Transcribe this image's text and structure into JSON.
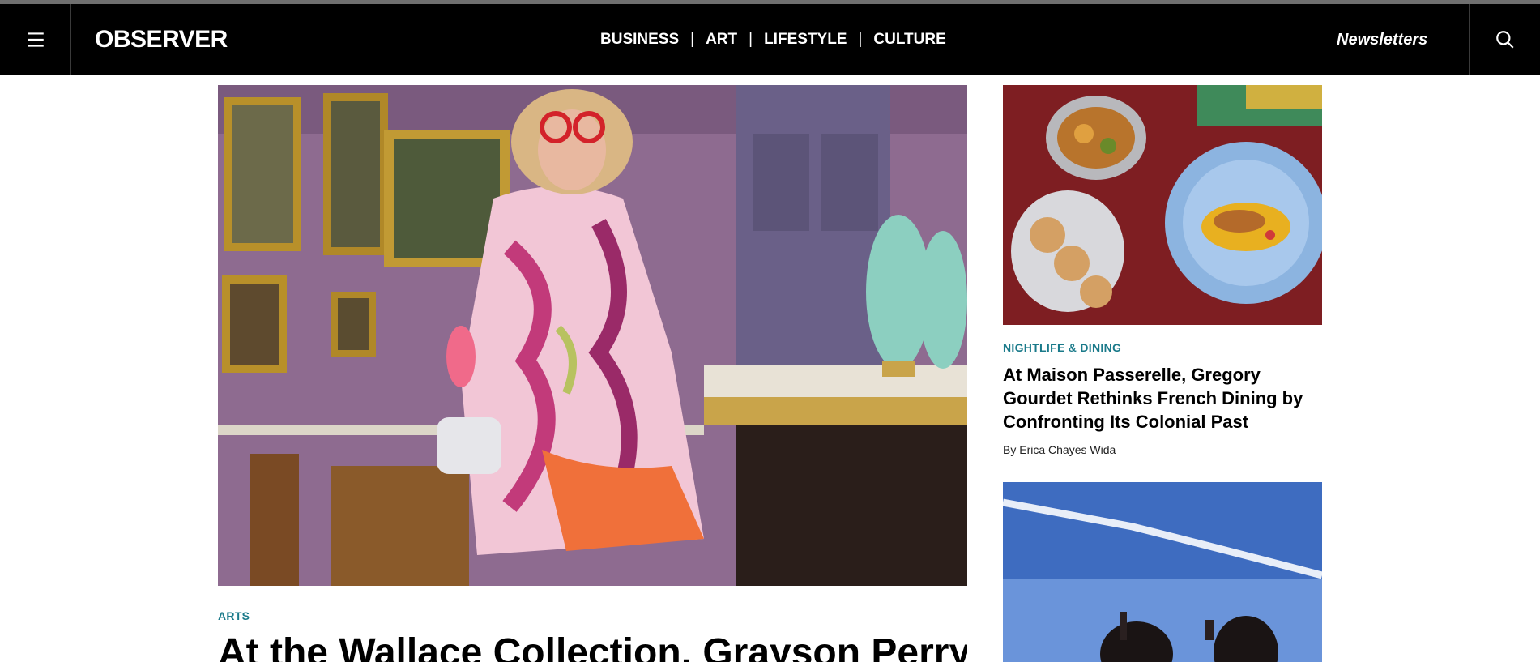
{
  "header": {
    "logo": "OBSERVER",
    "nav": [
      "BUSINESS",
      "ART",
      "LIFESTYLE",
      "CULTURE"
    ],
    "nav_separator": "|",
    "newsletters_label": "Newsletters",
    "menu_icon": "hamburger-menu-icon",
    "search_icon": "search-icon"
  },
  "feature": {
    "category": "ARTS",
    "title": "At the Wallace Collection, Grayson Perry"
  },
  "side_story": {
    "category": "NIGHTLIFE & DINING",
    "title": "At Maison Passerelle, Gregory Gourdet Rethinks French Dining by Confronting Its Colonial Past",
    "byline": "By Erica Chayes Wida"
  },
  "colors": {
    "header_bg": "#000000",
    "category_accent": "#1a7a8a"
  }
}
